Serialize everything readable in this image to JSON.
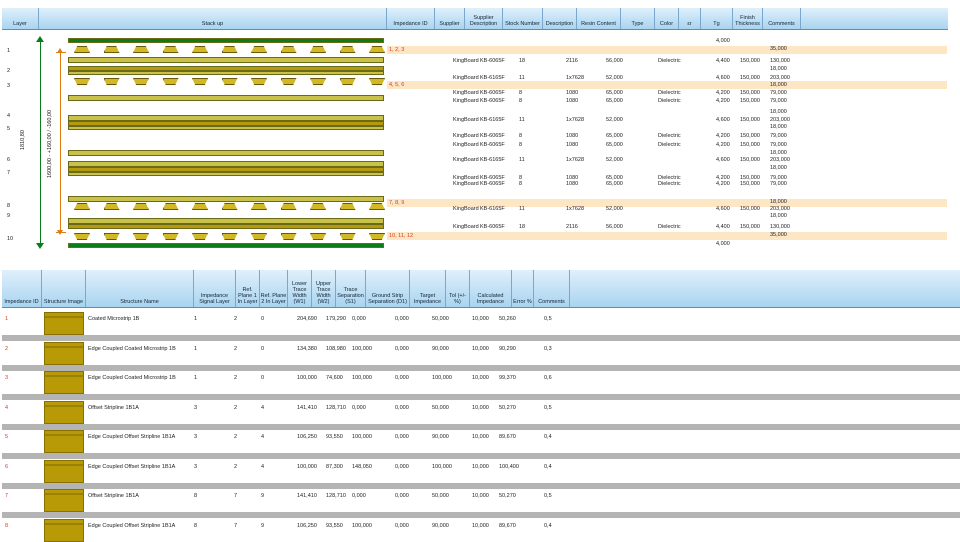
{
  "stackup": {
    "headers": [
      "Layer",
      "Stack up",
      "Impedance ID",
      "Supplier",
      "Supplier Description",
      "Stock Number",
      "Description",
      "Resin Content",
      "Type",
      "Color",
      "εr",
      "Tg",
      "Finish Thickness",
      "Comments"
    ],
    "layer_numbers": [
      "1",
      "2",
      "3",
      "4",
      "5",
      "6",
      "7",
      "8",
      "9",
      "10"
    ],
    "total_dim": "1810,80",
    "inner_dim": "1600,00 - +160,00 / -160,00",
    "imp_rows": [
      {
        "ids": "1, 2, 3"
      },
      {
        "ids": "4, 5, 6"
      },
      {
        "ids": "7, 8, 9"
      },
      {
        "ids": "10, 11, 12"
      }
    ],
    "rows": [
      {
        "supplier": "",
        "desc": "",
        "stock": "",
        "description": "",
        "resin": "",
        "type": "",
        "er": "4,000",
        "tg": "",
        "finish": ""
      },
      {
        "supplier": "",
        "desc": "",
        "stock": "",
        "description": "",
        "resin": "",
        "type": "",
        "er": "",
        "tg": "",
        "finish": "35,000"
      },
      {
        "supplier": "KingBoard",
        "desc": "KB-6065F",
        "stock": "18",
        "description": "2116",
        "resin": "56,000",
        "type": "Dielectric",
        "er": "4,400",
        "tg": "150,000",
        "finish": "130,000"
      },
      {
        "supplier": "",
        "desc": "",
        "stock": "",
        "description": "",
        "resin": "",
        "type": "",
        "er": "",
        "tg": "",
        "finish": "18,000"
      },
      {
        "supplier": "KingBoard",
        "desc": "KB-6165F",
        "stock": "11",
        "description": "1x7628",
        "resin": "52,000",
        "type": "",
        "er": "4,600",
        "tg": "150,000",
        "finish": "203,000"
      },
      {
        "supplier": "",
        "desc": "",
        "stock": "",
        "description": "",
        "resin": "",
        "type": "",
        "er": "",
        "tg": "",
        "finish": "18,000"
      },
      {
        "supplier": "KingBoard",
        "desc": "KB-6065F",
        "stock": "8",
        "description": "1080",
        "resin": "65,000",
        "type": "Dielectric",
        "er": "4,200",
        "tg": "150,000",
        "finish": "79,000"
      },
      {
        "supplier": "KingBoard",
        "desc": "KB-6065F",
        "stock": "8",
        "description": "1080",
        "resin": "65,000",
        "type": "Dielectric",
        "er": "4,200",
        "tg": "150,000",
        "finish": "79,000"
      },
      {
        "supplier": "",
        "desc": "",
        "stock": "",
        "description": "",
        "resin": "",
        "type": "",
        "er": "",
        "tg": "",
        "finish": "18,000"
      },
      {
        "supplier": "KingBoard",
        "desc": "KB-6165F",
        "stock": "11",
        "description": "1x7628",
        "resin": "52,000",
        "type": "",
        "er": "4,600",
        "tg": "150,000",
        "finish": "203,000"
      },
      {
        "supplier": "",
        "desc": "",
        "stock": "",
        "description": "",
        "resin": "",
        "type": "",
        "er": "",
        "tg": "",
        "finish": "18,000"
      },
      {
        "supplier": "KingBoard",
        "desc": "KB-6065F",
        "stock": "8",
        "description": "1080",
        "resin": "65,000",
        "type": "Dielectric",
        "er": "4,200",
        "tg": "150,000",
        "finish": "79,000"
      },
      {
        "supplier": "KingBoard",
        "desc": "KB-6065F",
        "stock": "8",
        "description": "1080",
        "resin": "65,000",
        "type": "Dielectric",
        "er": "4,200",
        "tg": "150,000",
        "finish": "79,000"
      },
      {
        "supplier": "",
        "desc": "",
        "stock": "",
        "description": "",
        "resin": "",
        "type": "",
        "er": "",
        "tg": "",
        "finish": "18,000"
      },
      {
        "supplier": "KingBoard",
        "desc": "KB-6165F",
        "stock": "11",
        "description": "1x7628",
        "resin": "52,000",
        "type": "",
        "er": "4,600",
        "tg": "150,000",
        "finish": "203,000"
      },
      {
        "supplier": "",
        "desc": "",
        "stock": "",
        "description": "",
        "resin": "",
        "type": "",
        "er": "",
        "tg": "",
        "finish": "18,000"
      },
      {
        "supplier": "KingBoard",
        "desc": "KB-6065F",
        "stock": "8",
        "description": "1080",
        "resin": "65,000",
        "type": "Dielectric",
        "er": "4,200",
        "tg": "150,000",
        "finish": "79,000"
      },
      {
        "supplier": "KingBoard",
        "desc": "KB-6065F",
        "stock": "8",
        "description": "1080",
        "resin": "65,000",
        "type": "Dielectric",
        "er": "4,200",
        "tg": "150,000",
        "finish": "79,000"
      },
      {
        "supplier": "",
        "desc": "",
        "stock": "",
        "description": "",
        "resin": "",
        "type": "",
        "er": "",
        "tg": "",
        "finish": "18,000"
      },
      {
        "supplier": "KingBoard",
        "desc": "KB-6165F",
        "stock": "11",
        "description": "1x7628",
        "resin": "52,000",
        "type": "",
        "er": "4,600",
        "tg": "150,000",
        "finish": "203,000"
      },
      {
        "supplier": "",
        "desc": "",
        "stock": "",
        "description": "",
        "resin": "",
        "type": "",
        "er": "",
        "tg": "",
        "finish": "18,000"
      },
      {
        "supplier": "KingBoard",
        "desc": "KB-6065F",
        "stock": "18",
        "description": "2116",
        "resin": "56,000",
        "type": "Dielectric",
        "er": "4,400",
        "tg": "150,000",
        "finish": "130,000"
      },
      {
        "supplier": "",
        "desc": "",
        "stock": "",
        "description": "",
        "resin": "",
        "type": "",
        "er": "",
        "tg": "",
        "finish": "35,000"
      },
      {
        "supplier": "",
        "desc": "",
        "stock": "",
        "description": "",
        "resin": "",
        "type": "",
        "er": "4,000",
        "tg": "",
        "finish": ""
      }
    ]
  },
  "impedance": {
    "headers": [
      "Impedance ID",
      "Structure Image",
      "Structure Name",
      "Impedance Signal Layer",
      "Ref. Plane 1 In Layer",
      "Ref. Plane 2 In Layer",
      "Lower Trace Width (W1)",
      "Upper Trace Width (W2)",
      "Trace Separation (S1)",
      "Ground Strip Separation (D1)",
      "Target Impedance",
      "Tol (+/- %)",
      "Calculated Impedance",
      "Error %",
      "Comments"
    ],
    "rows": [
      {
        "id": "1",
        "name": "Coated Microstrip 1B",
        "sig": "1",
        "r1": "2",
        "r2": "0",
        "w1": "204,690",
        "w2": "179,290",
        "s1": "0,000",
        "d1": "0,000",
        "target": "50,000",
        "tol": "10,000",
        "calc": "50,260",
        "err": "0,5"
      },
      {
        "id": "2",
        "name": "Edge Coupled Coated Microstrip 1B",
        "sig": "1",
        "r1": "2",
        "r2": "0",
        "w1": "134,380",
        "w2": "108,980",
        "s1": "100,000",
        "d1": "0,000",
        "target": "90,000",
        "tol": "10,000",
        "calc": "90,290",
        "err": "0,3"
      },
      {
        "id": "3",
        "name": "Edge Coupled Coated Microstrip 1B",
        "sig": "1",
        "r1": "2",
        "r2": "0",
        "w1": "100,000",
        "w2": "74,600",
        "s1": "100,000",
        "d1": "0,000",
        "target": "100,000",
        "tol": "10,000",
        "calc": "99,370",
        "err": "0,6"
      },
      {
        "id": "4",
        "name": "Offset Stripline 1B1A",
        "sig": "3",
        "r1": "2",
        "r2": "4",
        "w1": "141,410",
        "w2": "128,710",
        "s1": "0,000",
        "d1": "0,000",
        "target": "50,000",
        "tol": "10,000",
        "calc": "50,270",
        "err": "0,5"
      },
      {
        "id": "5",
        "name": "Edge Coupled Offset Stripline 1B1A",
        "sig": "3",
        "r1": "2",
        "r2": "4",
        "w1": "106,250",
        "w2": "93,550",
        "s1": "100,000",
        "d1": "0,000",
        "target": "90,000",
        "tol": "10,000",
        "calc": "89,670",
        "err": "0,4"
      },
      {
        "id": "6",
        "name": "Edge Coupled Offset Stripline 1B1A",
        "sig": "3",
        "r1": "2",
        "r2": "4",
        "w1": "100,000",
        "w2": "87,300",
        "s1": "148,050",
        "d1": "0,000",
        "target": "100,000",
        "tol": "10,000",
        "calc": "100,400",
        "err": "0,4"
      },
      {
        "id": "7",
        "name": "Offset Stripline 1B1A",
        "sig": "8",
        "r1": "7",
        "r2": "9",
        "w1": "141,410",
        "w2": "128,710",
        "s1": "0,000",
        "d1": "0,000",
        "target": "50,000",
        "tol": "10,000",
        "calc": "50,270",
        "err": "0,5"
      },
      {
        "id": "8",
        "name": "Edge Coupled Offset Stripline 1B1A",
        "sig": "8",
        "r1": "7",
        "r2": "9",
        "w1": "106,250",
        "w2": "93,550",
        "s1": "100,000",
        "d1": "0,000",
        "target": "90,000",
        "tol": "10,000",
        "calc": "89,670",
        "err": "0,4"
      }
    ]
  },
  "colors": {
    "copper": "#0a7d1a",
    "prepreg": "#c8c24a",
    "core": "#b59a10",
    "trace": "#d2b824",
    "header": "#a9d4f0",
    "accent_red": "#d9391f",
    "imp_row": "#fde6c4"
  }
}
